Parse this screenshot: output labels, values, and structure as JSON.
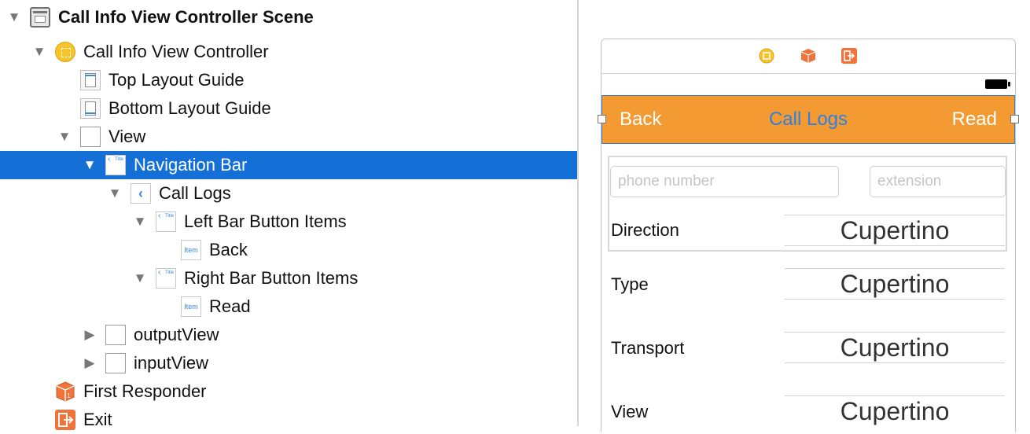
{
  "outline": {
    "scene_title": "Call Info View Controller Scene",
    "view_controller": "Call Info View Controller",
    "top_layout_guide": "Top Layout Guide",
    "bottom_layout_guide": "Bottom Layout Guide",
    "view": "View",
    "navigation_bar": "Navigation Bar",
    "call_logs": "Call Logs",
    "left_bar_button_items": "Left Bar Button Items",
    "back_item": "Back",
    "right_bar_button_items": "Right Bar Button Items",
    "read_item": "Read",
    "output_view": "outputView",
    "input_view": "inputView",
    "first_responder": "First Responder",
    "exit": "Exit",
    "item_icon_text": "Item",
    "title_icon_text": "Title"
  },
  "canvas": {
    "navbar": {
      "back": "Back",
      "title": "Call Logs",
      "read": "Read"
    },
    "phone_placeholder": "phone number",
    "extension_placeholder": "extension",
    "rows": [
      {
        "label": "Direction",
        "value": "Cupertino"
      },
      {
        "label": "Type",
        "value": "Cupertino"
      },
      {
        "label": "Transport",
        "value": "Cupertino"
      },
      {
        "label": "View",
        "value": "Cupertino"
      }
    ]
  },
  "colors": {
    "selection": "#1470d6",
    "navbar_bg": "#f39b32",
    "nav_title": "#2f7fe0",
    "vc_icon": "#f5c42a",
    "first_responder_icon": "#f0743a",
    "exit_icon": "#f0743a"
  }
}
